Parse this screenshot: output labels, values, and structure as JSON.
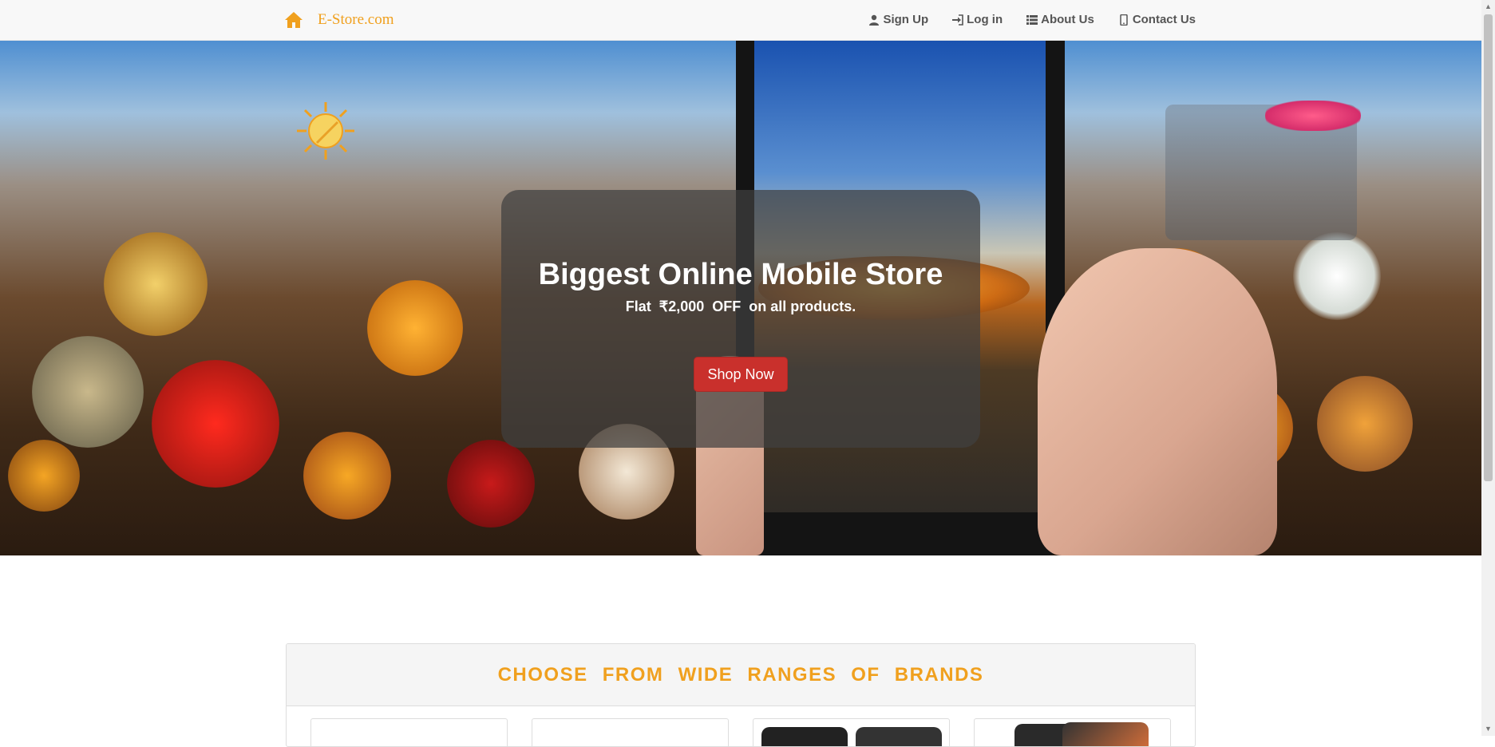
{
  "navbar": {
    "brand": "E-Store.com",
    "brand_icon": "home-icon",
    "links": [
      {
        "label": "Sign Up",
        "icon": "user-icon"
      },
      {
        "label": "Log in",
        "icon": "log-in-icon"
      },
      {
        "label": "About Us",
        "icon": "list-icon"
      },
      {
        "label": "Contact Us",
        "icon": "phone-icon"
      }
    ]
  },
  "hero": {
    "title": "Biggest Online Mobile Store",
    "subtitle": "Flat  ₹2,000  OFF  on all products.",
    "cta": "Shop Now"
  },
  "brands": {
    "title": "CHOOSE FROM WIDE RANGES OF BRANDS"
  },
  "colors": {
    "accent": "#f0a01e",
    "cta": "#c9302c",
    "navbar_bg": "#f8f8f8"
  }
}
